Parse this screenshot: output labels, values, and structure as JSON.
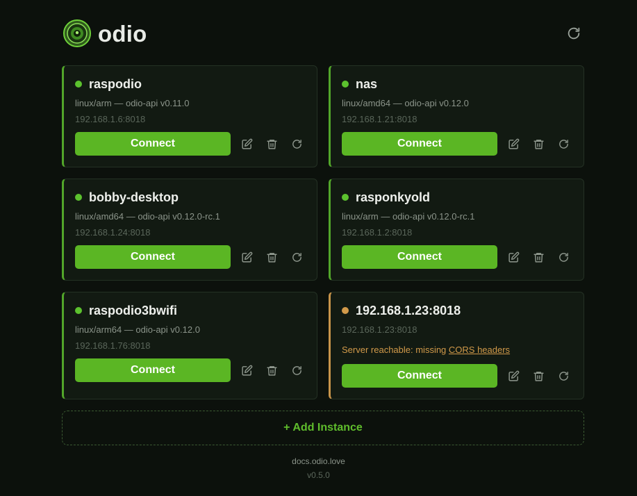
{
  "app": {
    "name": "odio",
    "logo_icon": "speaker-icon",
    "refresh_icon": "refresh-icon"
  },
  "colors": {
    "accent": "#5bb624",
    "online": "#5cc22e",
    "warning": "#d29a4a",
    "background": "#0c110c"
  },
  "instances": [
    {
      "name": "raspodio",
      "status": "online",
      "meta": "linux/arm — odio-api v0.11.0",
      "address": "192.168.1.6:8018",
      "connect_label": "Connect"
    },
    {
      "name": "nas",
      "status": "online",
      "meta": "linux/amd64 — odio-api v0.12.0",
      "address": "192.168.1.21:8018",
      "connect_label": "Connect"
    },
    {
      "name": "bobby-desktop",
      "status": "online",
      "meta": "linux/amd64 — odio-api v0.12.0-rc.1",
      "address": "192.168.1.24:8018",
      "connect_label": "Connect"
    },
    {
      "name": "rasponkyold",
      "status": "online",
      "meta": "linux/arm — odio-api v0.12.0-rc.1",
      "address": "192.168.1.2:8018",
      "connect_label": "Connect"
    },
    {
      "name": "raspodio3bwifi",
      "status": "online",
      "meta": "linux/arm64 — odio-api v0.12.0",
      "address": "192.168.1.76:8018",
      "connect_label": "Connect"
    },
    {
      "name": "192.168.1.23:8018",
      "status": "warning",
      "address": "192.168.1.23:8018",
      "warning_text": "Server reachable: missing ",
      "warning_link": "CORS headers",
      "connect_label": "Connect"
    }
  ],
  "add_instance_label": "+ Add Instance",
  "footer": {
    "link": "docs.odio.love",
    "version": "v0.5.0"
  }
}
